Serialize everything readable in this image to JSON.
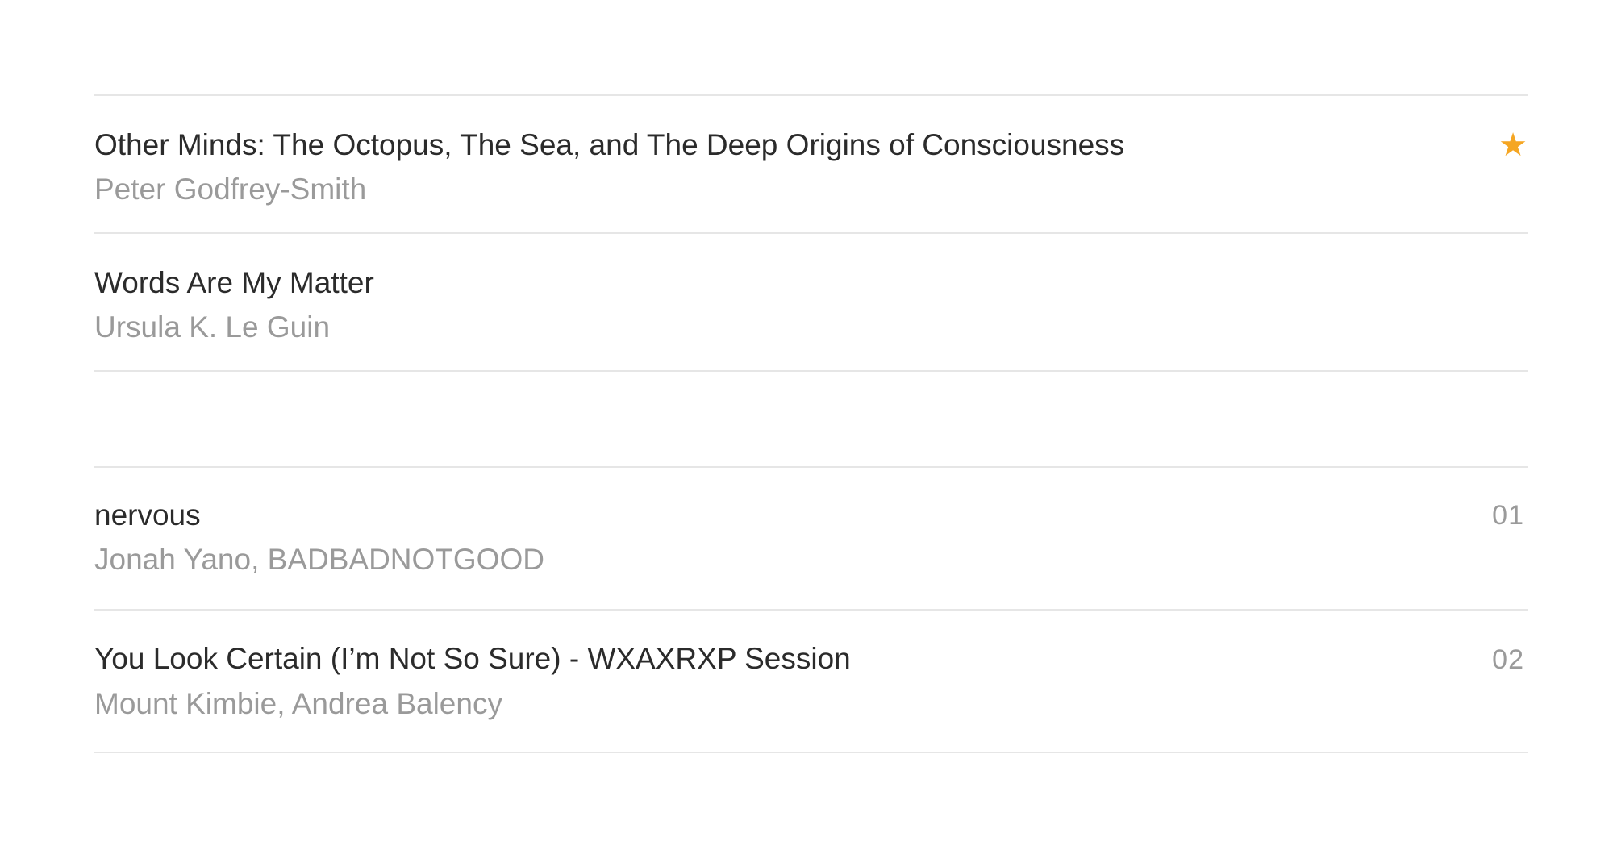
{
  "books": [
    {
      "title": "Other Minds: The Octopus, The Sea, and The Deep Origins of Consciousness",
      "author": "Peter Godfrey-Smith",
      "starred": true,
      "star_glyph": "★",
      "star_icon": "star-icon",
      "star_color": "#f5a623"
    },
    {
      "title": "Words Are My Matter",
      "author": "Ursula K. Le Guin",
      "starred": false
    }
  ],
  "tracks": [
    {
      "number": "01",
      "title": "nervous",
      "artists": "Jonah Yano, BADBADNOTGOOD"
    },
    {
      "number": "02",
      "title": "You Look Certain (I’m Not So Sure) - WXAXRXP Session",
      "artists": "Mount Kimbie, Andrea Balency"
    }
  ],
  "colors": {
    "title_text": "#2b2b2b",
    "secondary_text": "#9a9a9a",
    "divider": "#e6e6e6",
    "accent_star": "#f5a623"
  }
}
